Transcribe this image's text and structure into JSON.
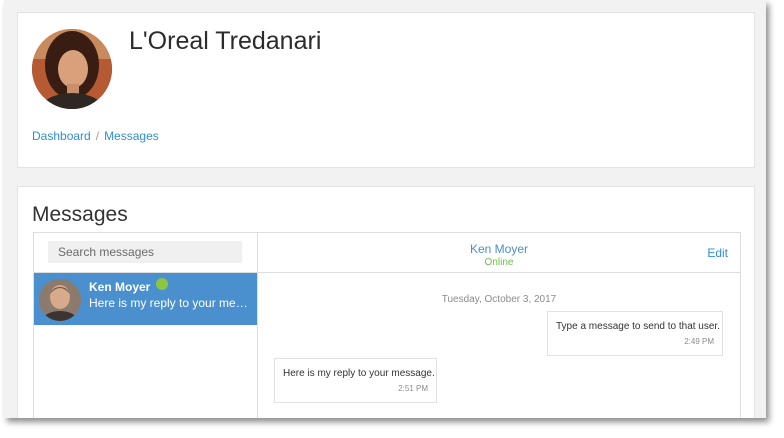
{
  "profile": {
    "name": "L'Oreal Tredanari",
    "avatar_icon": "user-photo"
  },
  "breadcrumb": {
    "dashboard": "Dashboard",
    "separator": "/",
    "current": "Messages"
  },
  "messages": {
    "title": "Messages",
    "search": {
      "placeholder": "Search messages"
    },
    "contacts": [
      {
        "name": "Ken Moyer",
        "preview": "Here is my reply to your message.",
        "online": true,
        "avatar_icon": "user-photo"
      }
    ],
    "conversation": {
      "contact_name": "Ken Moyer",
      "status": "Online",
      "edit_label": "Edit",
      "day": "Tuesday, October 3, 2017",
      "items": [
        {
          "direction": "sent",
          "text": "Type a message to send to that user.",
          "time": "2:49 PM"
        },
        {
          "direction": "received",
          "text": "Here is my reply to your message.",
          "time": "2:51 PM"
        }
      ]
    }
  },
  "colors": {
    "accent": "#2f8fce",
    "selected_contact": "#4a90cf",
    "online": "#8cc63f",
    "page_background": "#f2f2f2"
  }
}
